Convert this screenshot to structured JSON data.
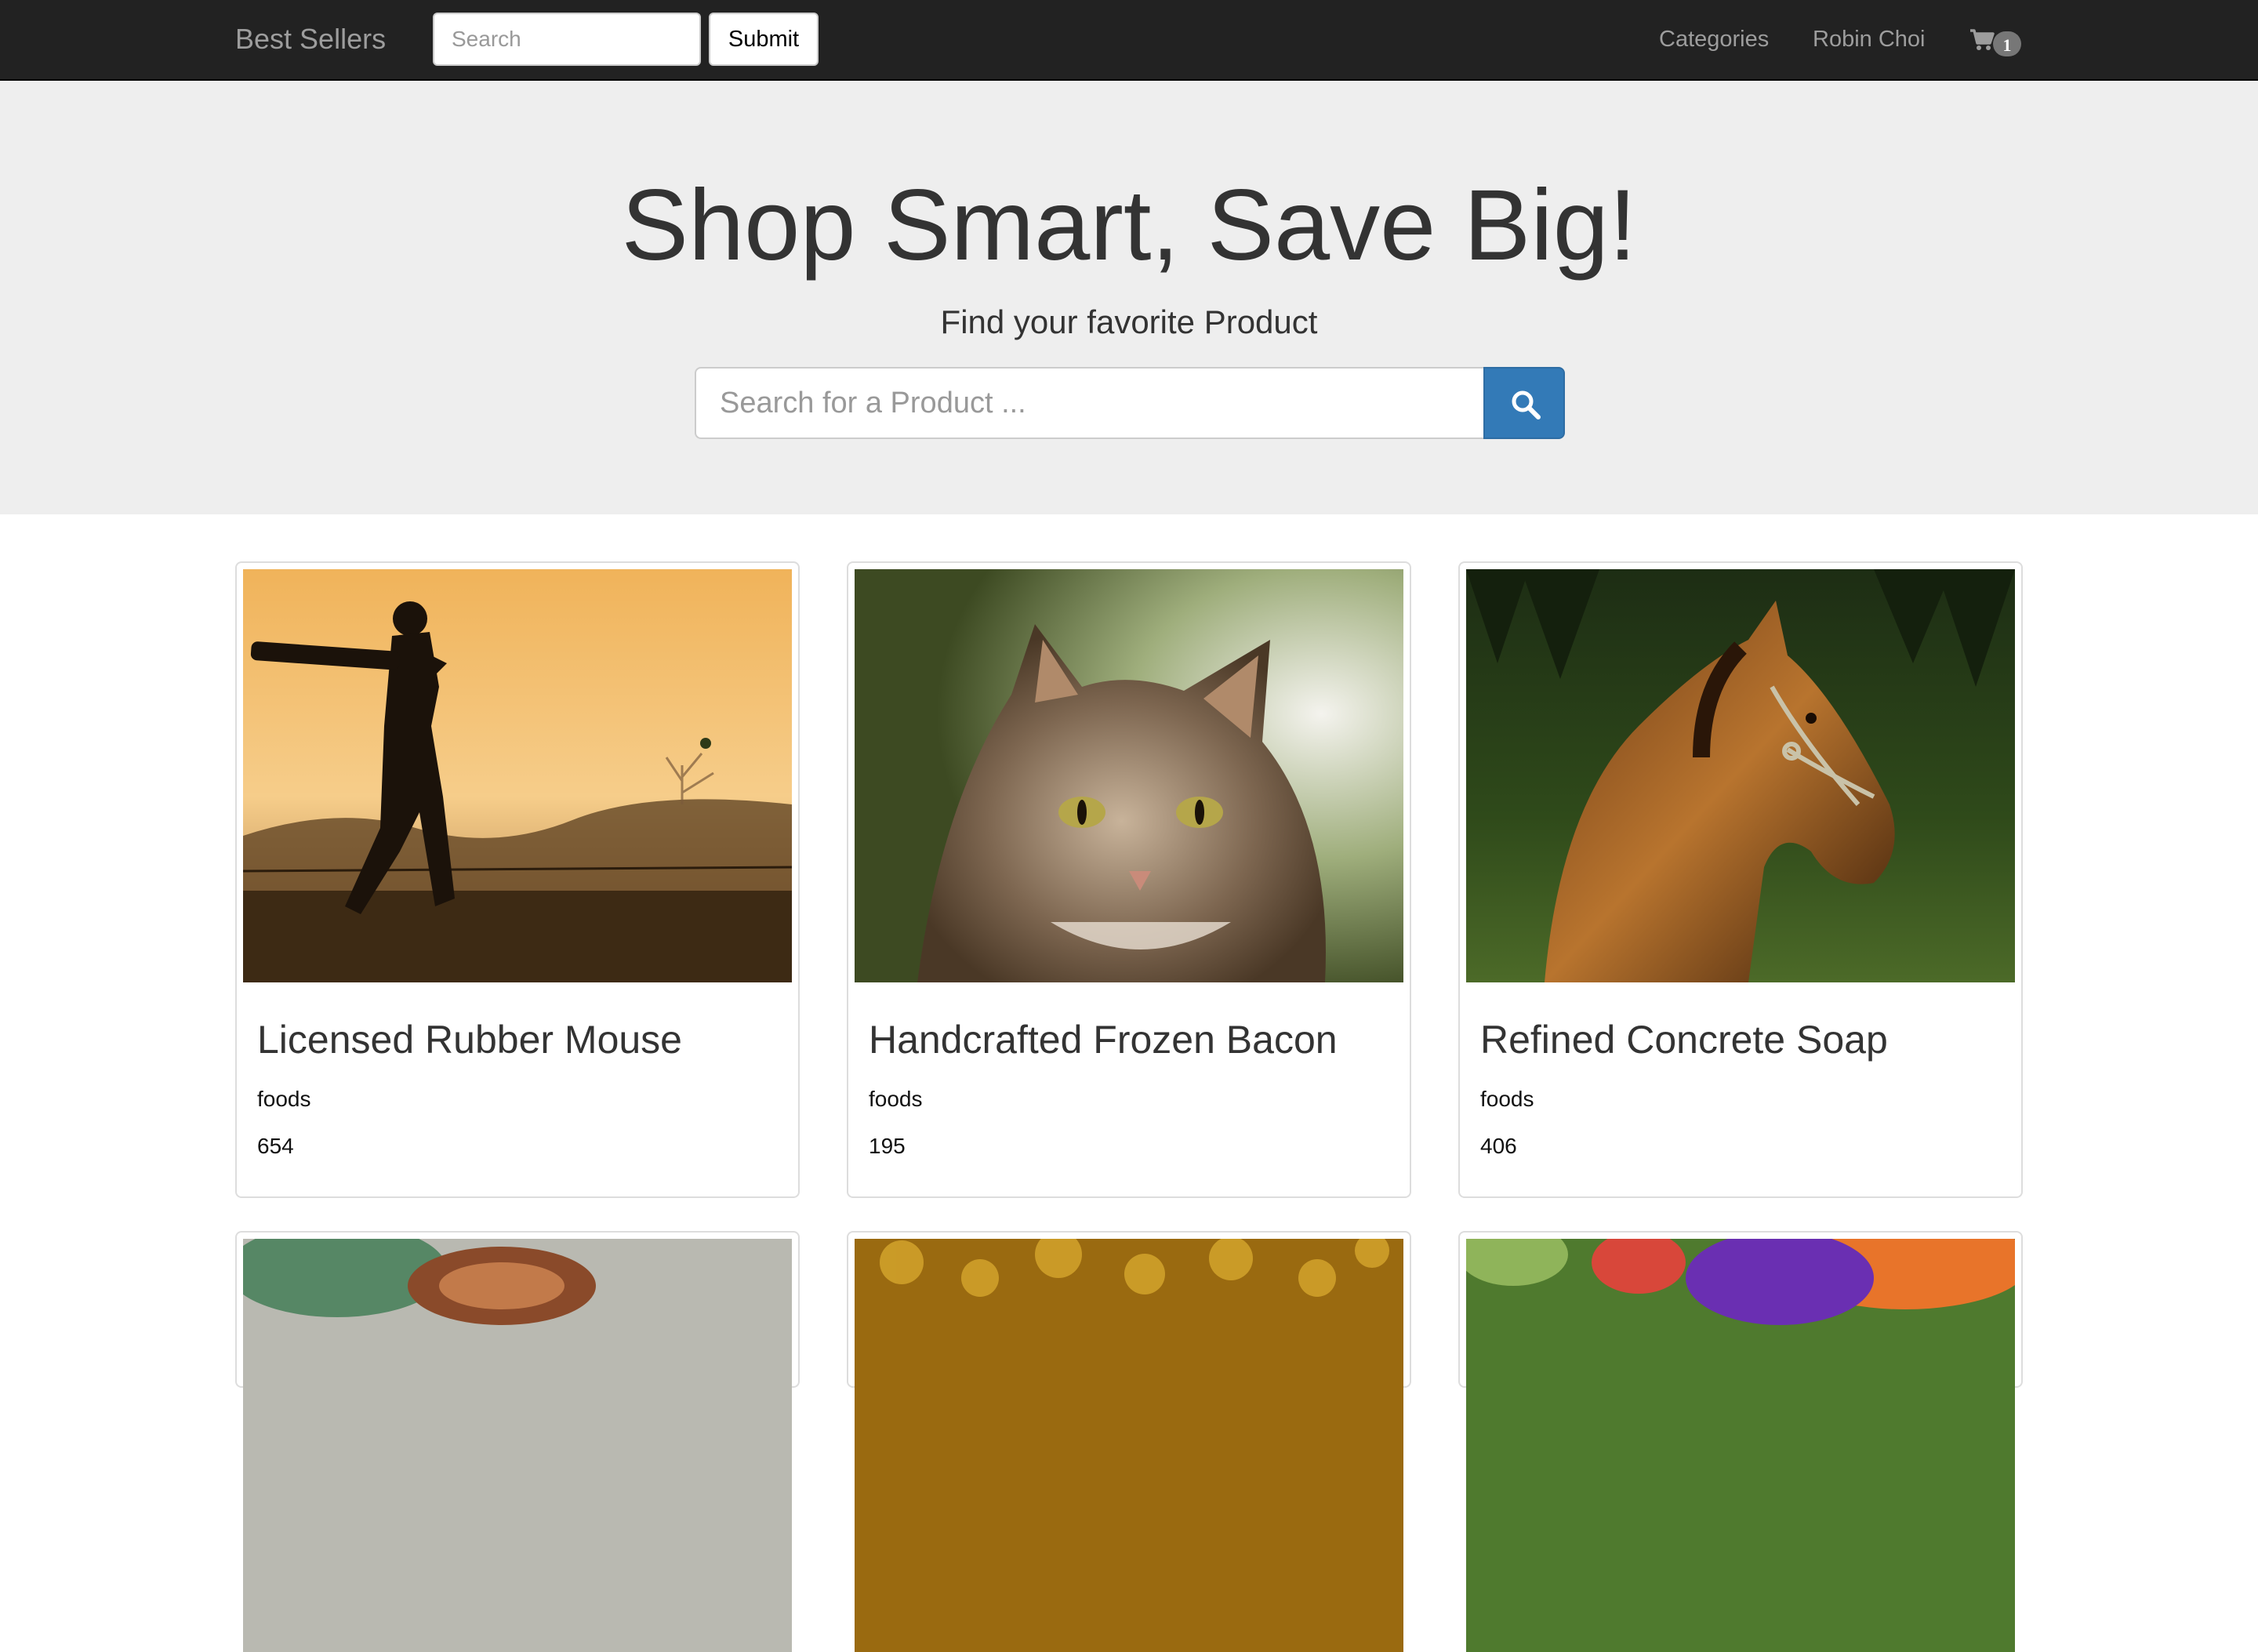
{
  "navbar": {
    "brand": "Best Sellers",
    "search_placeholder": "Search",
    "submit_label": "Submit",
    "links": [
      "Categories",
      "Robin Choi"
    ],
    "cart_count": "1"
  },
  "hero": {
    "title": "Shop Smart, Save Big!",
    "subtitle": "Find your favorite Product",
    "search_placeholder": "Search for a Product ..."
  },
  "products": [
    {
      "name": "Licensed Rubber Mouse",
      "category": "foods",
      "price": "654",
      "image": "cricket-batsman-silhouette"
    },
    {
      "name": "Handcrafted Frozen Bacon",
      "category": "foods",
      "price": "195",
      "image": "fluffy-cat"
    },
    {
      "name": "Refined Concrete Soap",
      "category": "foods",
      "price": "406",
      "image": "brown-horse"
    },
    {
      "name": "",
      "category": "",
      "price": "",
      "image": "copper-coil"
    },
    {
      "name": "",
      "category": "",
      "price": "",
      "image": "golden-bokeh"
    },
    {
      "name": "",
      "category": "",
      "price": "",
      "image": "purple-flowers"
    }
  ],
  "colors": {
    "navbar_bg": "#222222",
    "jumbotron_bg": "#eeeeee",
    "primary_button": "#337ab7"
  }
}
